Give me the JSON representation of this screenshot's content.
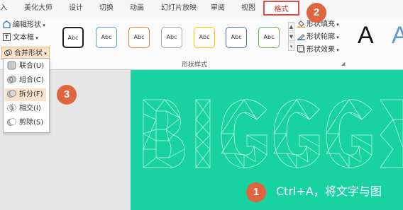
{
  "tabs": {
    "insert_partial": "入",
    "beautify": "美化大师",
    "design": "设计",
    "transition": "切换",
    "animation": "动画",
    "slideshow": "幻灯片放映",
    "review": "审阅",
    "view": "视图",
    "format": "格式"
  },
  "ribbon": {
    "edit_shape": "编辑形状",
    "textbox": "文本框",
    "merge_shapes": "合并形状",
    "shape_styles_group": "形状样式",
    "style_samples": [
      "Abc",
      "Abc",
      "Abc",
      "Abc",
      "Abc",
      "Abc",
      "Abc"
    ],
    "style_colors": [
      "#222222",
      "#5b9bd5",
      "#ed7d31",
      "#a5a5a5",
      "#ffc000",
      "#4472c4",
      "#70ad47"
    ],
    "shape_fill": "形状填充",
    "shape_outline": "形状轮廓",
    "shape_effects": "形状效果",
    "wordart_1": "A",
    "wordart_2": "A"
  },
  "merge_menu": {
    "union": "联合(U)",
    "combine": "组合(C)",
    "fragment": "拆分(F)",
    "intersect": "相交(I)",
    "subtract": "剪除(S)"
  },
  "slide": {
    "instruction": "Ctrl+A，将文字与图",
    "bg_color": "#18d2a2"
  },
  "annotations": {
    "step1": "1",
    "step2": "2",
    "step3": "3",
    "badge_color": "#df6440"
  }
}
